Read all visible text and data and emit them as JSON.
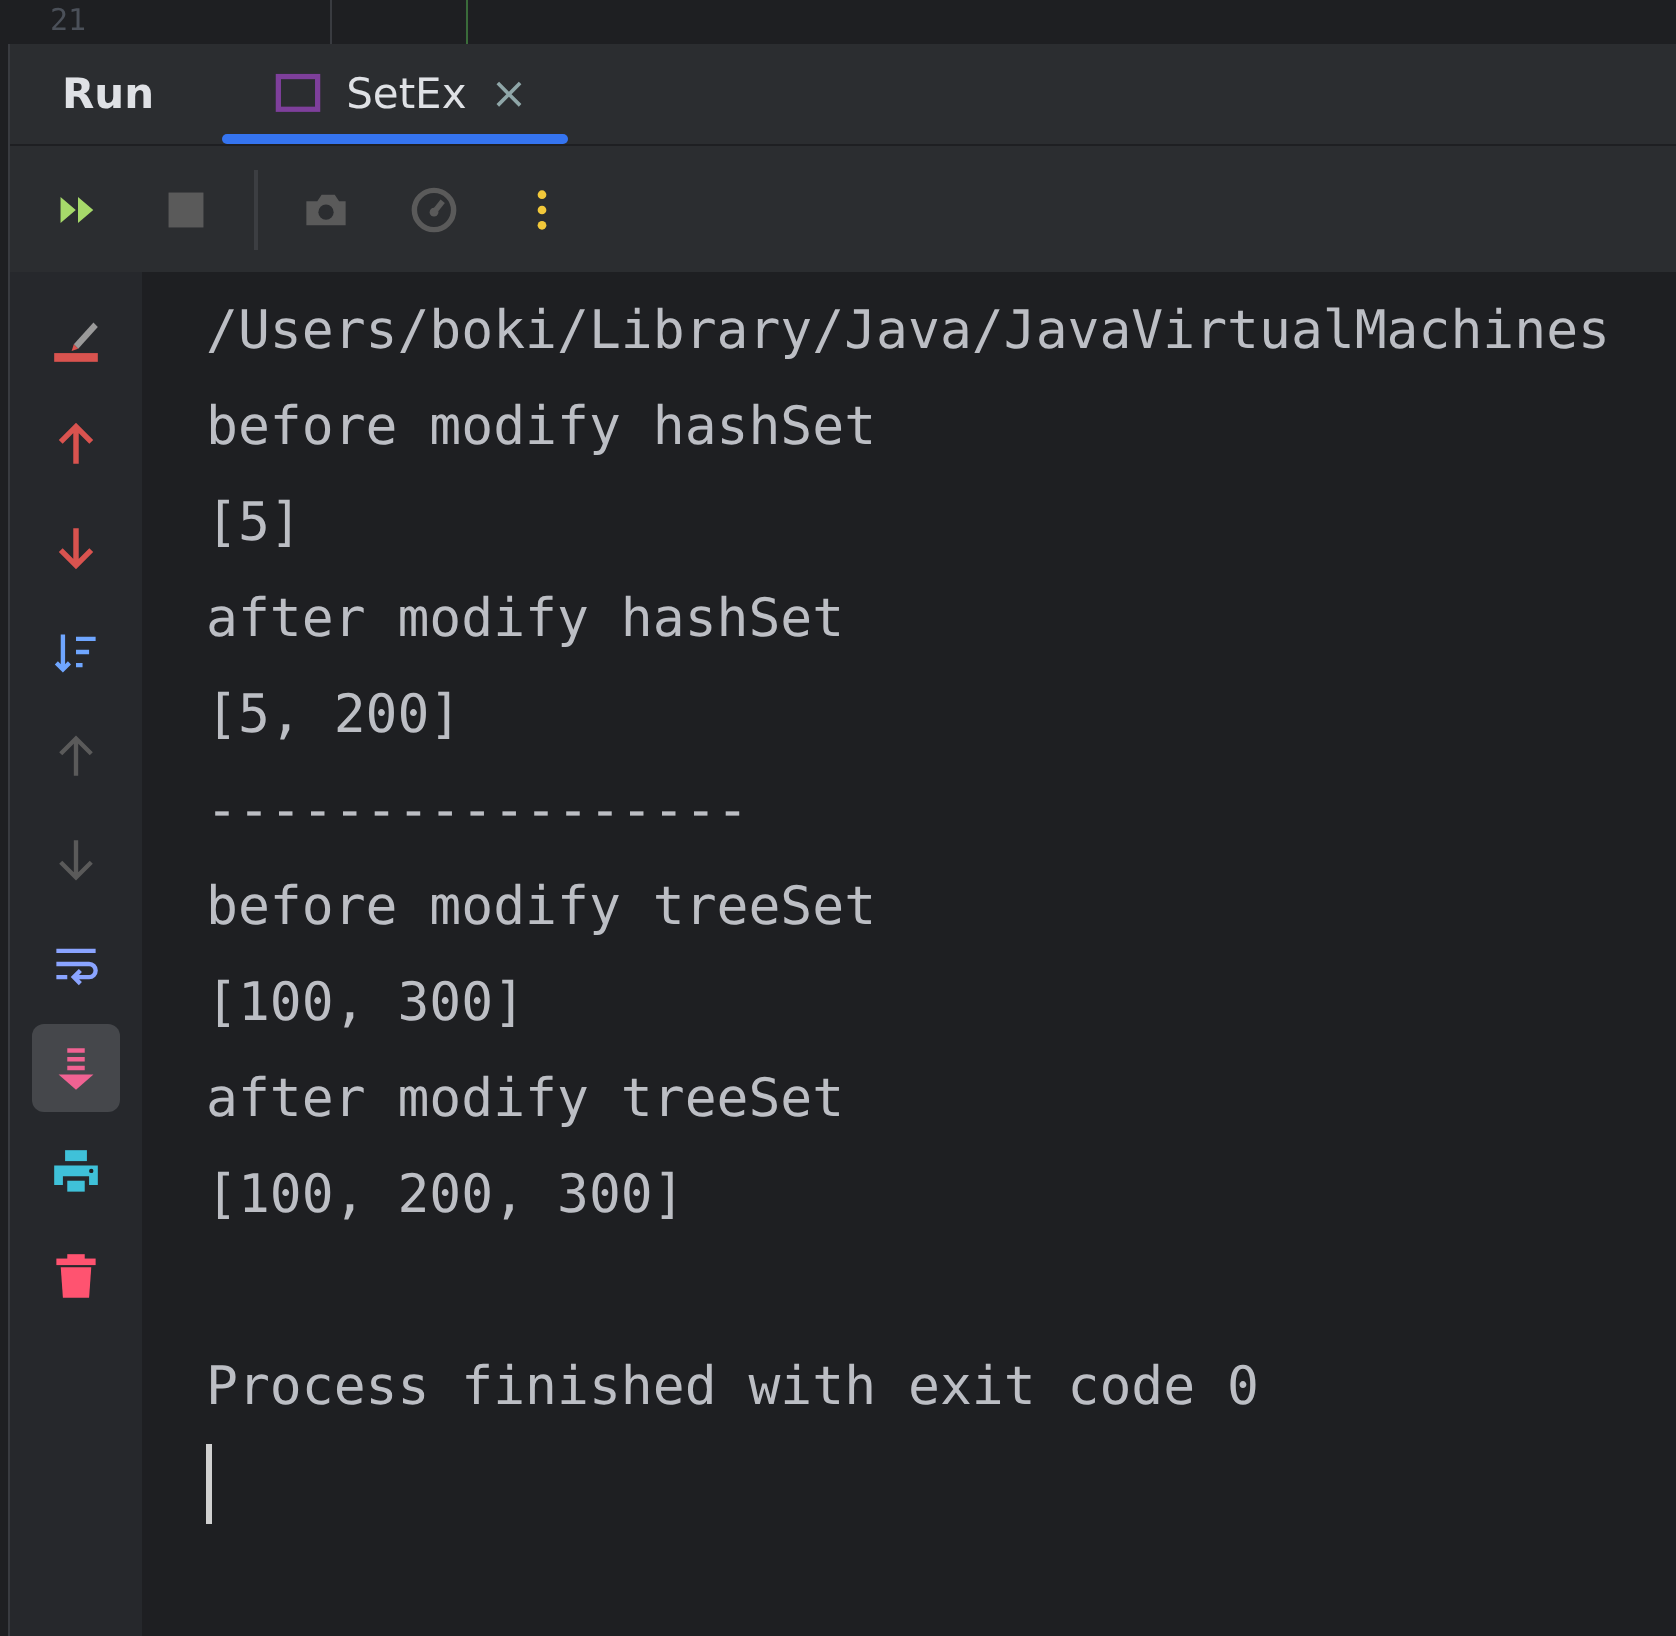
{
  "editor_strip": {
    "line_number": "21"
  },
  "run_panel": {
    "title": "Run",
    "tabs": [
      {
        "label": "SetEx",
        "selected": true,
        "close": "×"
      }
    ]
  },
  "toolbar": [
    {
      "kind": "rerun"
    },
    {
      "kind": "stop"
    },
    {
      "kind": "separator"
    },
    {
      "kind": "camera"
    },
    {
      "kind": "gauge"
    },
    {
      "kind": "more"
    }
  ],
  "side_tools": [
    {
      "kind": "clear",
      "selected": false
    },
    {
      "kind": "up-red",
      "selected": false
    },
    {
      "kind": "down-red",
      "selected": false
    },
    {
      "kind": "sort",
      "selected": false
    },
    {
      "kind": "up",
      "selected": false
    },
    {
      "kind": "down",
      "selected": false
    },
    {
      "kind": "wrap",
      "selected": false
    },
    {
      "kind": "scroll-end",
      "selected": true
    },
    {
      "kind": "print",
      "selected": false
    },
    {
      "kind": "trash",
      "selected": false
    }
  ],
  "console": {
    "lines": [
      {
        "kind": "text",
        "text": "/Users/boki/Library/Java/JavaVirtualMachines"
      },
      {
        "kind": "text",
        "text": "before modify hashSet"
      },
      {
        "kind": "text",
        "text": "[5]"
      },
      {
        "kind": "text",
        "text": "after modify hashSet"
      },
      {
        "kind": "text",
        "text": "[5, 200]"
      },
      {
        "kind": "text",
        "text": "-----------------"
      },
      {
        "kind": "text",
        "text": "before modify treeSet"
      },
      {
        "kind": "text",
        "text": "[100, 300]"
      },
      {
        "kind": "text",
        "text": "after modify treeSet"
      },
      {
        "kind": "text",
        "text": "[100, 200, 300]"
      },
      {
        "kind": "blank"
      },
      {
        "kind": "text",
        "text": "Process finished with exit code 0"
      }
    ],
    "caret": true
  }
}
